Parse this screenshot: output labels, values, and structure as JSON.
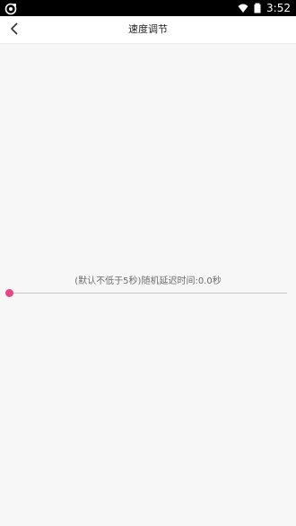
{
  "status_bar": {
    "time": "3:52"
  },
  "header": {
    "title": "速度调节",
    "back_icon": "chevron-left-icon"
  },
  "main": {
    "delay_label": "(默认不低于5秒)随机延迟时间:0.0秒",
    "slider": {
      "value": 0.0,
      "min": 0,
      "thumb_color": "#e64684",
      "track_color": "#c8c8c8"
    }
  },
  "colors": {
    "accent": "#e64684",
    "background": "#f7f7f7",
    "status_bar": "#000000"
  }
}
